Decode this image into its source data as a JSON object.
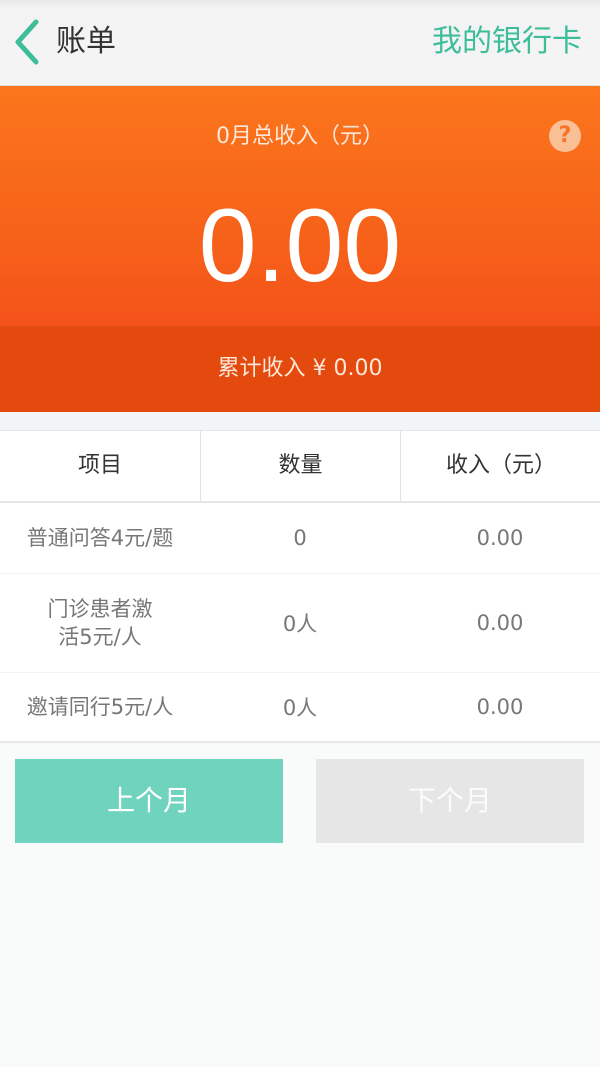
{
  "header": {
    "title": "账单",
    "bank_card_link": "我的银行卡"
  },
  "summary": {
    "month_label": "0月总收入（元）",
    "month_total": "0.00",
    "help_icon": "?",
    "cumulative_label": "累计收入 ¥ 0.00"
  },
  "table": {
    "columns": [
      "项目",
      "数量",
      "收入（元）"
    ],
    "rows": [
      {
        "item": "普通问答4元/题",
        "quantity": "0",
        "income": "0.00"
      },
      {
        "item": "门诊患者激活5元/人",
        "quantity": "0人",
        "income": "0.00"
      },
      {
        "item": "邀请同行5元/人",
        "quantity": "0人",
        "income": "0.00"
      }
    ]
  },
  "buttons": {
    "prev_month": "上个月",
    "next_month": "下个月"
  },
  "colors": {
    "accent_green": "#3dbd98",
    "button_green": "#6fd3bd",
    "hero_orange": "#f65f1a",
    "band_orange": "#e4490d",
    "disabled_gray": "#e6e6e6"
  }
}
